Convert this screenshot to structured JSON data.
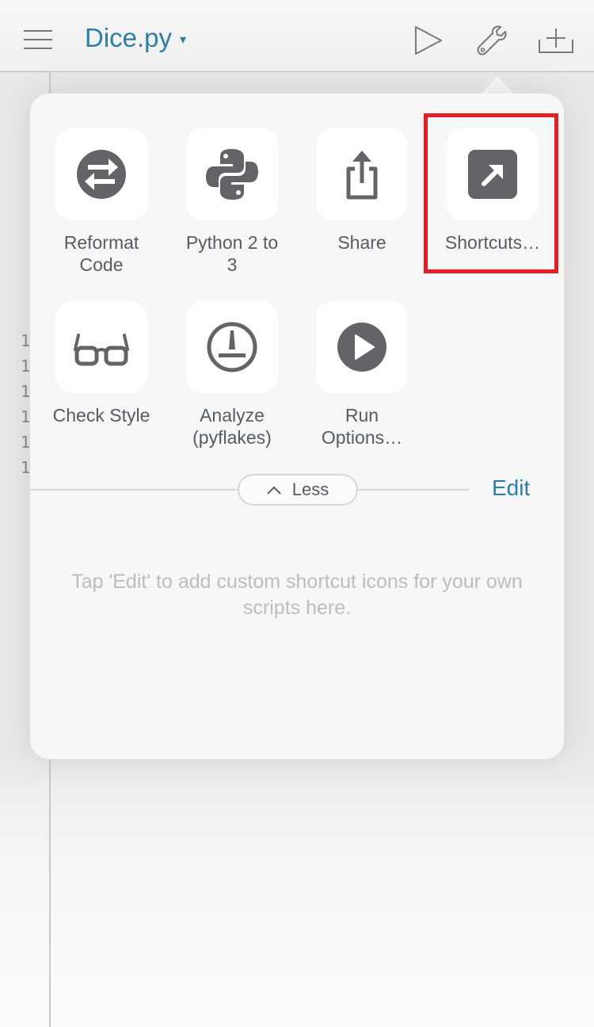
{
  "header": {
    "title": "Dice.py",
    "title_caret": "▾",
    "icons": [
      "menu-icon",
      "run-icon",
      "wrench-icon",
      "new-file-icon"
    ]
  },
  "editor": {
    "line_numbers": [
      "1",
      "1",
      "1",
      "1",
      "1",
      "1"
    ]
  },
  "actions": [
    {
      "label": "Reformat\nCode",
      "icon": "reformat-icon"
    },
    {
      "label": "Python 2 to\n3",
      "icon": "python-icon"
    },
    {
      "label": "Share",
      "icon": "share-icon"
    },
    {
      "label": "Shortcuts…",
      "icon": "shortcut-arrow-icon"
    },
    {
      "label": "Check Style",
      "icon": "glasses-icon"
    },
    {
      "label": "Analyze\n(pyflakes)",
      "icon": "gauge-icon"
    },
    {
      "label": "Run\nOptions…",
      "icon": "play-circle-icon"
    }
  ],
  "less_label": "Less",
  "edit_label": "Edit",
  "hint": "Tap 'Edit' to add custom shortcut icons for your own scripts here.",
  "colors": {
    "accent": "#2d7ea6",
    "icon": "#626468",
    "highlight": "#e81e25"
  }
}
